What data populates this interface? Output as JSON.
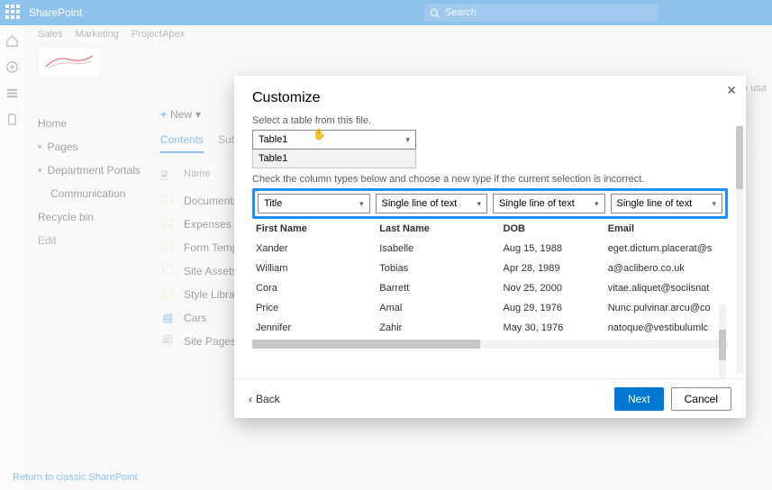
{
  "suite": {
    "product": "SharePoint",
    "search_placeholder": "Search"
  },
  "breadcrumbs": [
    "Sales",
    "Marketing",
    "ProjectApex"
  ],
  "leftnav": {
    "home": "Home",
    "pages": "Pages",
    "dept": "Department Portals",
    "comm": "Communication",
    "recycle": "Recycle bin",
    "edit": "Edit",
    "classic": "Return to classic SharePoint"
  },
  "cmdbar": {
    "new": "New"
  },
  "tabs": {
    "contents": "Contents",
    "subsites": "Subsites"
  },
  "siteusage": "Site usa",
  "contentlist": {
    "name_header": "Name",
    "items": [
      {
        "label": "Documents",
        "kind": "folder"
      },
      {
        "label": "Expenses",
        "kind": "folder"
      },
      {
        "label": "Form Templates",
        "kind": "folder"
      },
      {
        "label": "Site Assets",
        "kind": "folder"
      },
      {
        "label": "Style Library",
        "kind": "folder"
      },
      {
        "label": "Cars",
        "kind": "list"
      },
      {
        "label": "Site Pages",
        "kind": "pages"
      }
    ]
  },
  "modal": {
    "title": "Customize",
    "select_label": "Select a table from this file.",
    "table_value": "Table1",
    "table_option": "Table1",
    "instructions": "Check the column types below and choose a new type if the current selection is incorrect.",
    "coltypes": [
      "Title",
      "Single line of text",
      "Single line of text",
      "Single line of text"
    ],
    "headers": [
      "First Name",
      "Last Name",
      "DOB",
      "Email"
    ],
    "rows": [
      [
        "Xander",
        "Isabelle",
        "Aug 15, 1988",
        "eget.dictum.placerat@s"
      ],
      [
        "William",
        "Tobias",
        "Apr 28, 1989",
        "a@aclibero.co.uk"
      ],
      [
        "Cora",
        "Barrett",
        "Nov 25, 2000",
        "vitae.aliquet@sociisnat"
      ],
      [
        "Price",
        "Amal",
        "Aug 29, 1976",
        "Nunc.pulvinar.arcu@co"
      ],
      [
        "Jennifer",
        "Zahir",
        "May 30, 1976",
        "natoque@vestibulumlc"
      ]
    ],
    "back": "Back",
    "next": "Next",
    "cancel": "Cancel"
  }
}
